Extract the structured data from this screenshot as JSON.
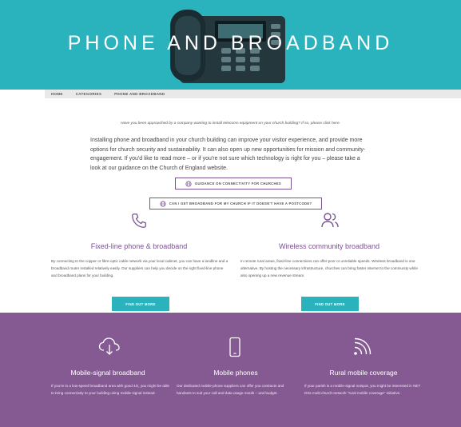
{
  "hero": {
    "title": "PHONE AND BROADBAND"
  },
  "nav": {
    "items": [
      "HOME",
      "CATEGORIES",
      "PHONE AND BROADBAND"
    ]
  },
  "notice": "Have you been approached by a company wanting to install telecoms equipment on your church building? If so, please click here.",
  "intro": "Installing phone and broadband in your church building can improve your visitor experience, and provide more options for church security and sustainability. It can also open up new opportunities for mission and community-engagement. If you'd like to read more – or if you're not sure which technology is right for you – please take a look at our guidance on the Church of England website.",
  "buttons": {
    "guidance": "GUIDANCE ON CONNECTIVITY FOR CHURCHES",
    "postcode": "CAN I GET BROADBAND FOR MY CHURCH IF IT DOESN'T HAVE A POSTCODE?"
  },
  "columns": [
    {
      "title": "Fixed-line phone & broadband",
      "text": "By connecting to the copper or fibre-optic cable network via your local cabinet, you can have a landline and a broadband router installed relatively easily. Our suppliers can help you decide on the right fixed-line phone and broadband plans for your building.",
      "button": "FIND OUT MORE",
      "icon": "phone-icon"
    },
    {
      "title": "Wireless community broadband",
      "text": "In remote rural areas, fixed-line connections can offer poor or unreliable speeds. Wireless broadband is one alternative. By hosting the necessary infrastructure, churches can bring faster internet to the community while also opening up a new revenue stream.",
      "button": "FIND OUT MORE",
      "icon": "users-icon"
    }
  ],
  "purple_section": [
    {
      "title": "Mobile-signal broadband",
      "text": "If you're in a low-speed broadband area with good 4G, you might be able to bring connectivity to your building using mobile signal instead.",
      "icon": "cloud-download-icon"
    },
    {
      "title": "Mobile phones",
      "text": "Our dedicated mobile-phone suppliers can offer you contracts and handsets to suit your call and data usage needs – and budget.",
      "icon": "mobile-phone-icon"
    },
    {
      "title": "Rural mobile coverage",
      "text": "If your parish is a mobile-signal notspot, you might be interested in NET DSs multi-church-network \"rural mobile coverage\" initiative.",
      "icon": "signal-icon"
    }
  ],
  "colors": {
    "teal": "#2bb3bd",
    "purple": "#855a93",
    "accent": "#7a5391"
  }
}
